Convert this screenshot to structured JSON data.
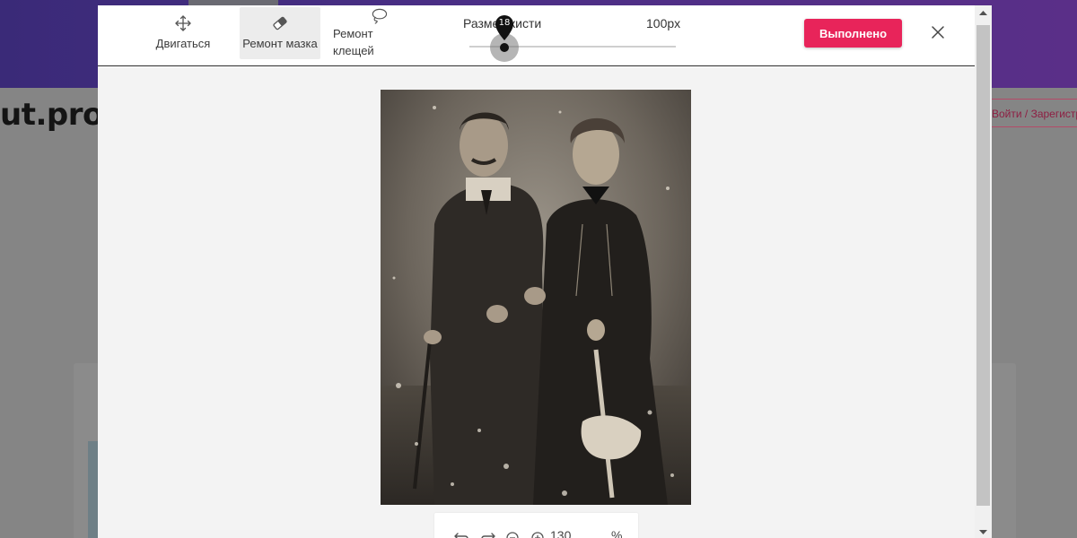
{
  "background_page": {
    "logo": "ut.pro",
    "auth_links": "Войти / Зарегистрироваться"
  },
  "toolbar": {
    "tools": [
      {
        "label": "Двигаться",
        "icon": "move-arrows-icon"
      },
      {
        "label": "Ремонт мазка",
        "icon": "eraser-icon",
        "selected": true
      },
      {
        "label": "Ремонт клещей",
        "icon": "lasso-icon"
      }
    ],
    "brush_size": {
      "label": "Размер кисти",
      "value_label": "100px",
      "slider_value": 18
    },
    "done_label": "Выполнено",
    "close_icon": "close-icon"
  },
  "image": {
    "subject": "old sepia photograph of a couple"
  },
  "zoom_bar": {
    "undo_icon": "undo-icon",
    "redo_icon": "redo-icon",
    "zoom_out_icon": "zoom-out-icon",
    "zoom_in_icon": "zoom-in-icon",
    "zoom_value": "130",
    "zoom_unit": "%"
  },
  "colors": {
    "accent": "#e8245a",
    "header_gradient_start": "#3a2a78",
    "canvas_bg": "#f3f3f3"
  }
}
